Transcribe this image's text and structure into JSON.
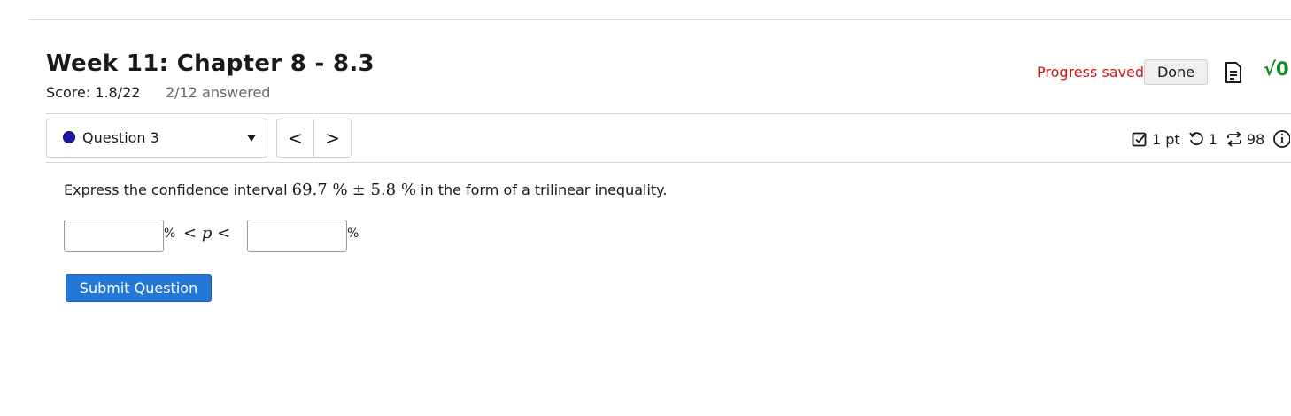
{
  "assignment": {
    "title": "Week 11: Chapter 8 - 8.3",
    "score": "Score: 1.8/22",
    "answered": "2/12 answered"
  },
  "header_actions": {
    "progress_status": "Progress saved",
    "done_label": "Done",
    "math_icon_text": "√0"
  },
  "question_nav": {
    "selected": "Question 3",
    "prev_label": "<",
    "next_label": ">"
  },
  "question_meta": {
    "points": "1 pt",
    "retries": "1",
    "attempts": "98"
  },
  "question": {
    "prompt_before": "Express the confidence interval",
    "math_value": "69.7 %",
    "math_pm": "± 5.8 %",
    "prompt_after": "in the form of a trilinear inequality.",
    "percent_symbol": "%",
    "inequality_lt_left": "<",
    "inequality_var": "p",
    "inequality_lt_right": "<",
    "lower_value": "",
    "upper_value": "",
    "submit_label": "Submit Question"
  },
  "colors": {
    "progress_saved": "#cc1616",
    "submit_button": "#2377d6",
    "math_icon": "#0f8a1f",
    "question_dot": "#1a1aa6"
  }
}
